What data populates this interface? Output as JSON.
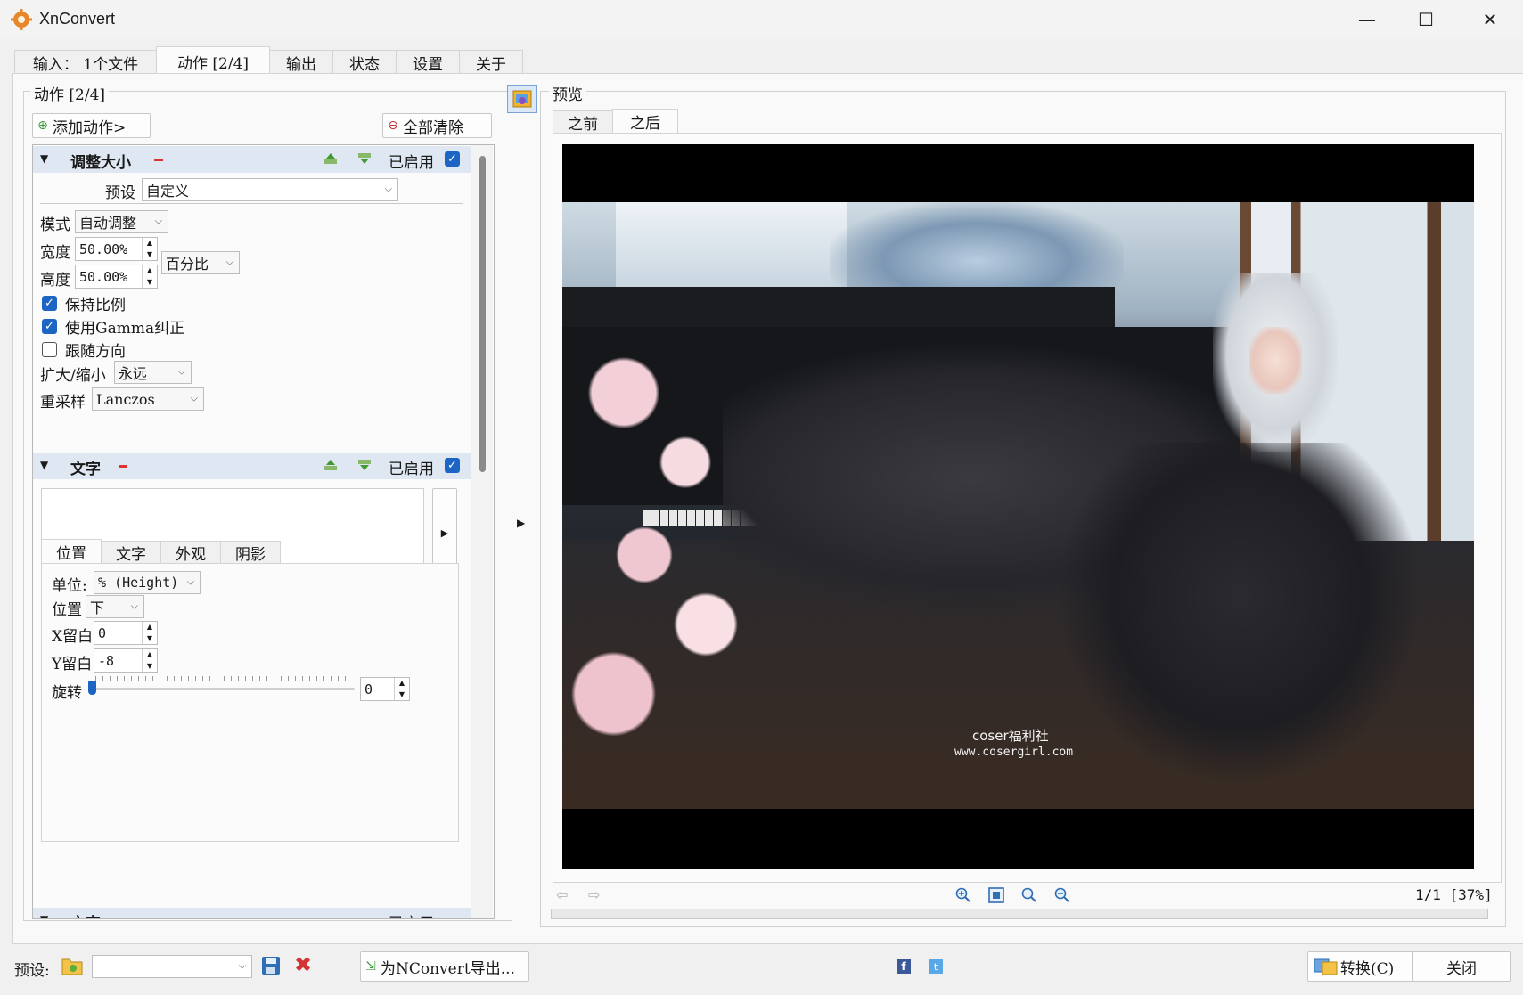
{
  "window": {
    "title": "XnConvert",
    "minimize": "—",
    "maximize": "☐",
    "close": "✕"
  },
  "tabs": [
    "输入： 1个文件",
    "动作 [2/4]",
    "输出",
    "状态",
    "设置",
    "关于"
  ],
  "actions_panel": {
    "group_title": "动作 [2/4]",
    "add_action": "添加动作>",
    "clear_all": "全部清除",
    "resize": {
      "title": "调整大小",
      "enabled_label": "已启用",
      "preset_label": "预设",
      "preset_value": "自定义",
      "mode_label": "模式",
      "mode_value": "自动调整",
      "width_label": "宽度",
      "width_value": "50.00%",
      "height_label": "高度",
      "height_value": "50.00%",
      "unit_value": "百分比",
      "keep_ratio": "保持比例",
      "use_gamma": "使用Gamma纠正",
      "follow_orientation": "跟随方向",
      "enlarge_label": "扩大/缩小",
      "enlarge_value": "永远",
      "resample_label": "重采样",
      "resample_value": "Lanczos"
    },
    "text_action": {
      "title": "文字",
      "enabled_label": "已启用",
      "subtabs": [
        "位置",
        "文字",
        "外观",
        "阴影"
      ],
      "unit_label": "单位:",
      "unit_value": "% (Height)",
      "position_label": "位置",
      "position_value": "下",
      "x_margin_label": "X留白",
      "x_margin_value": "0",
      "y_margin_label": "Y留白",
      "y_margin_value": "-8",
      "rotate_label": "旋转",
      "rotate_value": "0"
    },
    "text_action_2": {
      "title": "文字",
      "enabled_label": "已启用"
    }
  },
  "preview": {
    "group_title": "预览",
    "tabs": [
      "之前",
      "之后"
    ],
    "watermark_line1": "coser福利社",
    "watermark_line2": "www.cosergirl.com",
    "page_info": "1/1 [37%]"
  },
  "bottom": {
    "preset_label": "预设:",
    "preset_value": "",
    "export_nconvert": "为NConvert导出...",
    "convert": "转换(C)",
    "close": "关闭"
  },
  "colors": {
    "accent": "#1d65c4",
    "section_header": "#dfe8f2",
    "danger": "#d33333"
  }
}
